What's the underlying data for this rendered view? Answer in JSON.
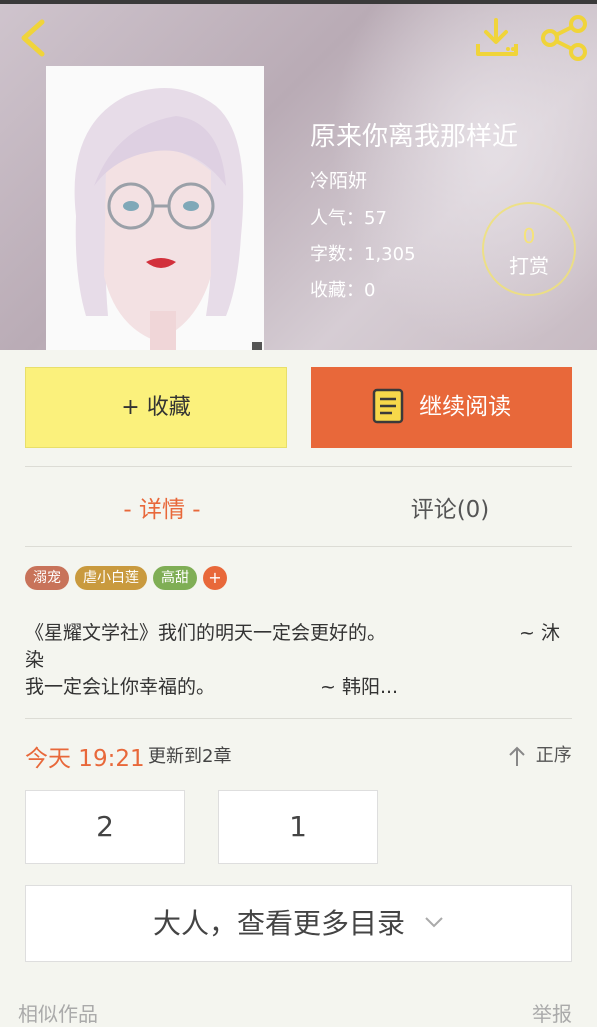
{
  "book": {
    "title": "原来你离我那样近",
    "author": "冷陌妍",
    "popularity": "人气：57",
    "word_count": "字数：1,305",
    "favorites": "收藏：0"
  },
  "tip": {
    "count": "0",
    "label": "打赏"
  },
  "actions": {
    "collect_label": "+ 收藏",
    "read_label": "继续阅读"
  },
  "tabs": [
    {
      "label": "- 详情 -",
      "active": true
    },
    {
      "label": "评论(0)",
      "active": false
    }
  ],
  "tags": [
    {
      "label": "溺宠",
      "color": "#c8735a"
    },
    {
      "label": "虐小白莲",
      "color": "#c99a3e"
    },
    {
      "label": "高甜",
      "color": "#7fae55"
    }
  ],
  "tag_add": "+",
  "intro": {
    "line1_left": "《星耀文学社》我们的明天一定会更好的。",
    "line1_right": "~ 沐",
    "line2": "染",
    "line3_left": "我一定会让你幸福的。",
    "line3_right": "~ 韩阳..."
  },
  "update": {
    "time": "今天 19:21",
    "text": "更新到2章"
  },
  "order_label": "正序",
  "chapters": [
    "2",
    "1"
  ],
  "more_label": "大人，查看更多目录",
  "footer": {
    "similar": "相似作品",
    "report": "举报"
  },
  "icons": [
    "back-icon",
    "download-icon",
    "share-icon",
    "book-icon",
    "arrow-up-icon",
    "chevron-down-icon"
  ],
  "colors": {
    "accent": "#e8683a",
    "collect_bg": "#fbf17c",
    "header_icons": "#f0d43a"
  }
}
